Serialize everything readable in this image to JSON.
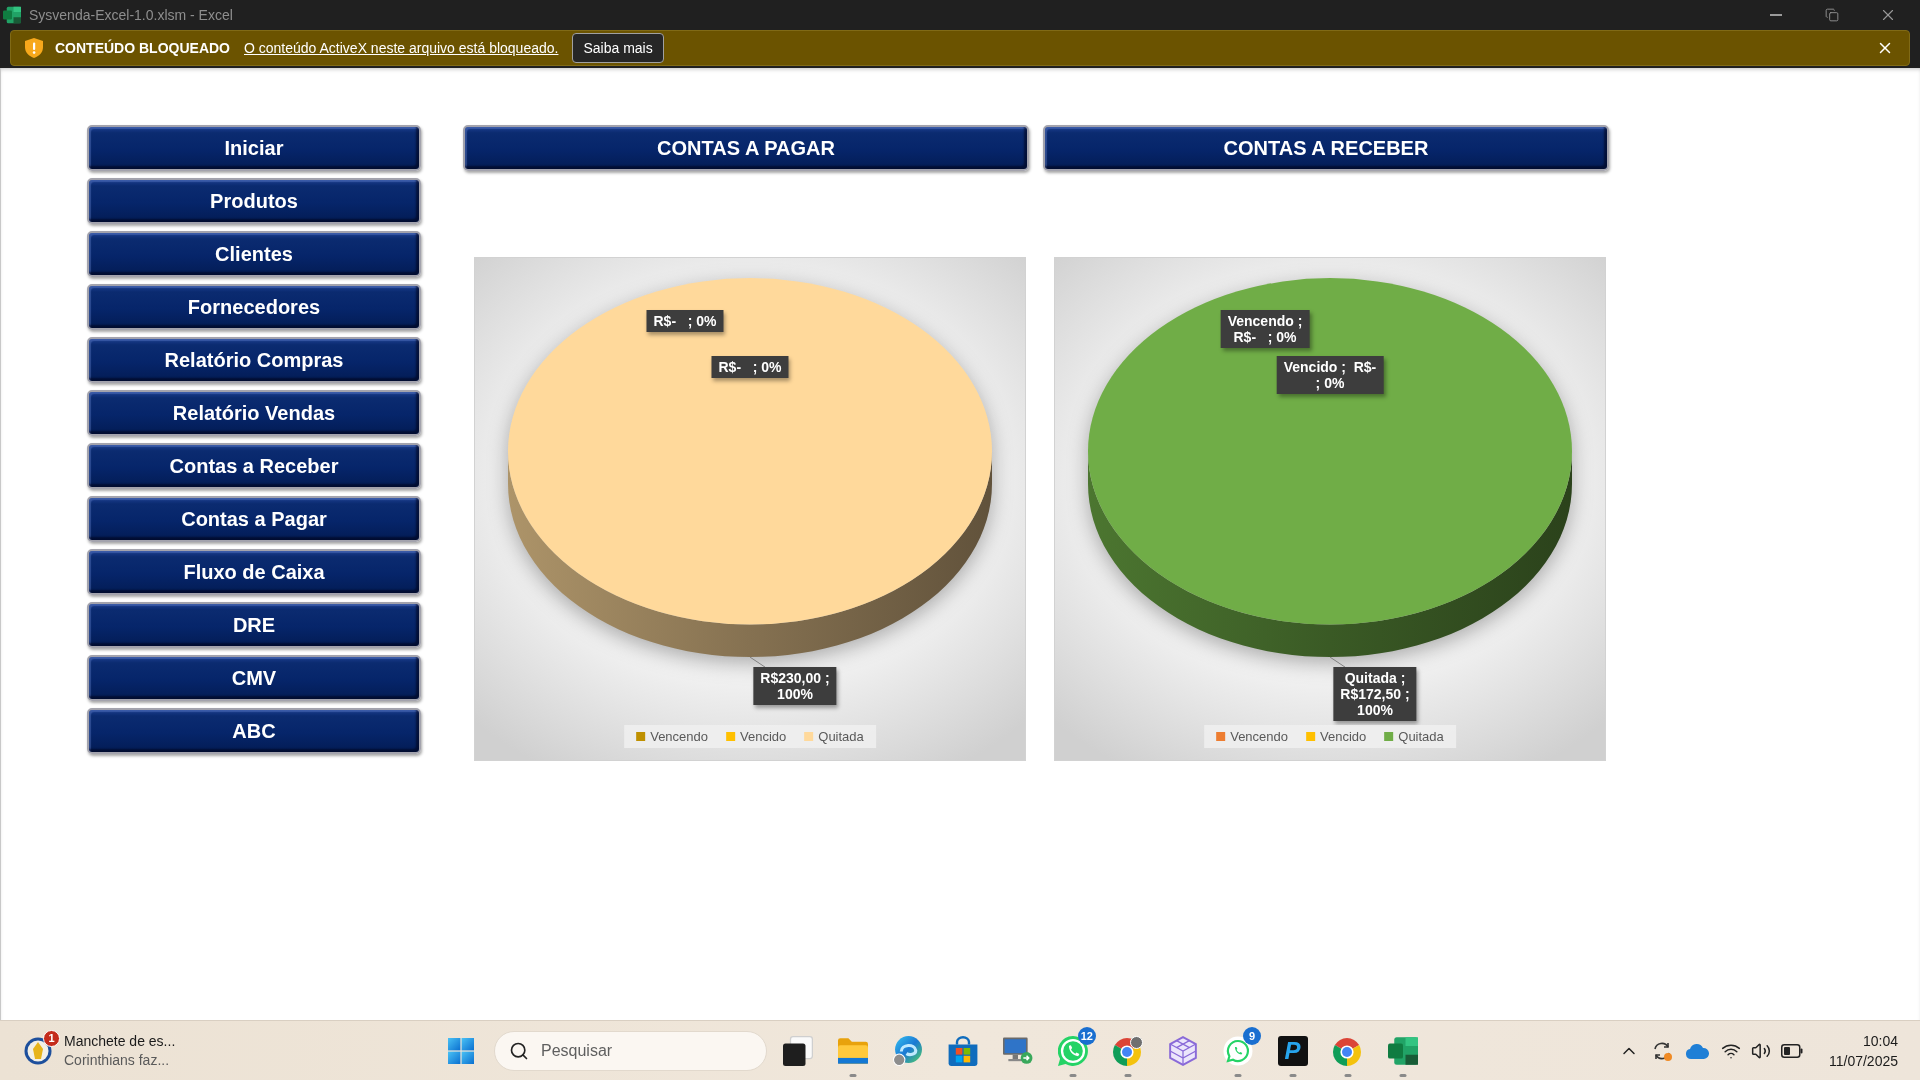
{
  "window": {
    "title": "Sysvenda-Excel-1.0.xlsm - Excel"
  },
  "message_bar": {
    "title": "CONTEÚDO BLOQUEADO",
    "message": "O conteúdo ActiveX neste arquivo está bloqueado.",
    "button": "Saiba mais"
  },
  "sidebar": {
    "buttons": [
      "Iniciar",
      "Produtos",
      "Clientes",
      "Fornecedores",
      "Relatório Compras",
      "Relatório Vendas",
      "Contas a Receber",
      "Contas a Pagar",
      "Fluxo de Caixa",
      "DRE",
      "CMV",
      "ABC"
    ]
  },
  "panels": [
    {
      "header": "CONTAS A PAGAR",
      "chart_data": {
        "type": "pie",
        "categories": [
          "Vencendo",
          "Vencido",
          "Quitada"
        ],
        "values": [
          0,
          0,
          230
        ],
        "colors": [
          "#bf9000",
          "#ffc000",
          "#ffd99b"
        ],
        "value_labels": [
          "R$-   ; 0%",
          "R$-   ; 0%",
          "R$230,00 ;\n100%"
        ]
      }
    },
    {
      "header": "CONTAS A RECEBER",
      "chart_data": {
        "type": "pie",
        "categories": [
          "Vencendo",
          "Vencido",
          "Quitada"
        ],
        "values": [
          0,
          0,
          172.5
        ],
        "colors": [
          "#ed7d31",
          "#ffc000",
          "#70ad47"
        ],
        "value_labels": [
          "Vencendo ;\nR$-   ; 0%",
          "Vencido ;  R$-\n; 0%",
          "Quitada ;\nR$172,50 ;\n100%"
        ]
      }
    }
  ],
  "taskbar": {
    "news": {
      "badge": "1",
      "headline": "Manchete de es...",
      "subtitle": "Corinthians faz..."
    },
    "search": {
      "placeholder": "Pesquisar"
    },
    "apps": [
      {
        "kind": "squares",
        "running": false
      },
      {
        "kind": "folder",
        "running": true
      },
      {
        "kind": "edge",
        "running": false
      },
      {
        "kind": "store",
        "running": false
      },
      {
        "kind": "remote",
        "running": false
      },
      {
        "kind": "whatsapp",
        "badge": "12",
        "running": true
      },
      {
        "kind": "chrome-profile",
        "running": true
      },
      {
        "kind": "cube",
        "running": false
      },
      {
        "kind": "whatsapp-light",
        "badge": "9",
        "running": true
      },
      {
        "kind": "logo-tile",
        "glyph": "P",
        "running": true
      },
      {
        "kind": "chrome",
        "running": true
      },
      {
        "kind": "excel",
        "running": true
      }
    ],
    "clock": {
      "time": "10:04",
      "date": "11/07/2025"
    }
  }
}
